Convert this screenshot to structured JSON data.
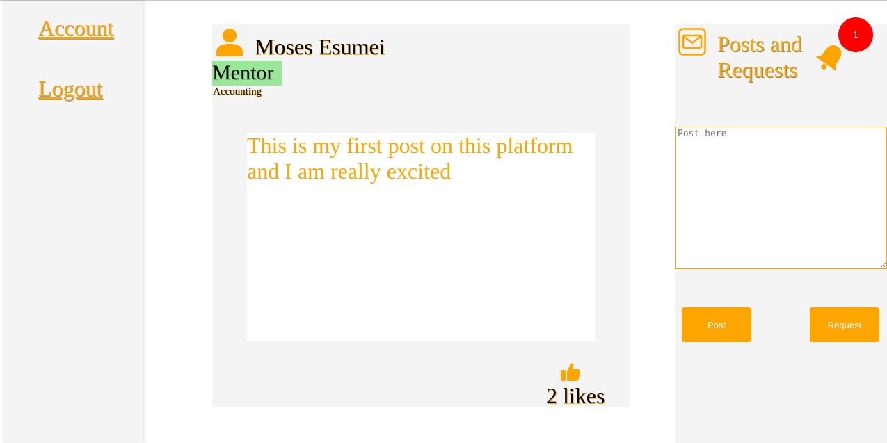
{
  "sidebar": {
    "items": [
      {
        "label": "Account"
      },
      {
        "label": "Logout"
      }
    ]
  },
  "post": {
    "author": "Moses Esumei",
    "role": "Mentor",
    "field": "Accounting",
    "body": "This is my first post on this platform\nand I am really excited",
    "likes_label": "2 likes",
    "icons": {
      "author": "user-icon",
      "like": "thumbs-up-icon"
    }
  },
  "panel": {
    "title": "Posts and Requests",
    "notification_count": "1",
    "input_placeholder": "Post here",
    "post_button": "Post",
    "request_button": "Request",
    "icons": {
      "mail": "envelope-icon",
      "bell": "bell-icon"
    }
  },
  "colors": {
    "accent": "#ffa500",
    "role_badge_bg": "#98e898",
    "notification_badge": "#ff0000",
    "panel_bg": "#f4f4f4"
  }
}
